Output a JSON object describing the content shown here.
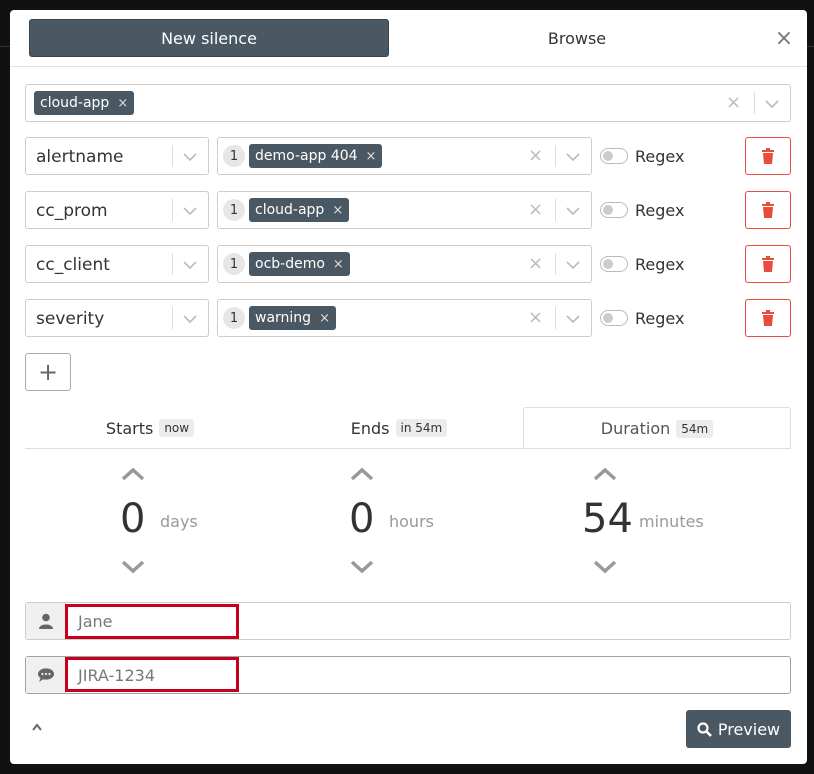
{
  "header": {
    "tab_new": "New silence",
    "tab_browse": "Browse",
    "close": "×"
  },
  "cluster_filter": {
    "chip": "cloud-app",
    "chip_remove": "×"
  },
  "matchers": [
    {
      "name": "alertname",
      "count": "1",
      "value": "demo-app 404",
      "remove": "×",
      "regex_label": "Regex"
    },
    {
      "name": "cc_prom",
      "count": "1",
      "value": "cloud-app",
      "remove": "×",
      "regex_label": "Regex"
    },
    {
      "name": "cc_client",
      "count": "1",
      "value": "ocb-demo",
      "remove": "×",
      "regex_label": "Regex"
    },
    {
      "name": "severity",
      "count": "1",
      "value": "warning",
      "remove": "×",
      "regex_label": "Regex"
    }
  ],
  "add_button": "+",
  "time_tabs": {
    "starts": {
      "label": "Starts",
      "badge": "now"
    },
    "ends": {
      "label": "Ends",
      "badge": "in 54m"
    },
    "duration": {
      "label": "Duration",
      "badge": "54m"
    }
  },
  "duration": {
    "days": {
      "value": "0",
      "unit": "days"
    },
    "hours": {
      "value": "0",
      "unit": "hours"
    },
    "minutes": {
      "value": "54",
      "unit": "minutes"
    }
  },
  "author": {
    "placeholder": "Jane"
  },
  "comment": {
    "placeholder": "JIRA-1234"
  },
  "footer": {
    "preview": "Preview"
  },
  "colors": {
    "primary": "#4a5863",
    "danger": "#e74c3c",
    "highlight": "#c8001b"
  }
}
